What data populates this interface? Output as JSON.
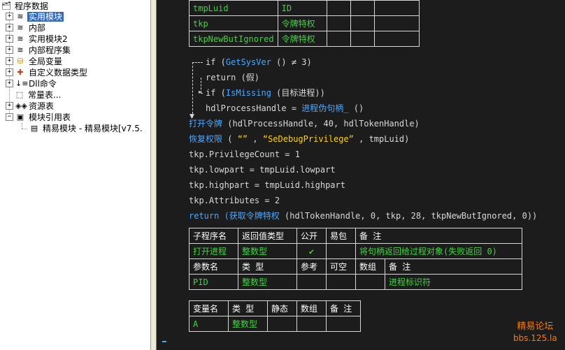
{
  "tree": {
    "root": "程序数据",
    "items": [
      {
        "label": "实用模块",
        "selected": true
      },
      {
        "label": "内部"
      },
      {
        "label": "实用模块2"
      },
      {
        "label": "内部程序集"
      },
      {
        "label": "全局变量"
      },
      {
        "label": "自定义数据类型"
      },
      {
        "label": "Dll命令"
      },
      {
        "label": "常量表..."
      },
      {
        "label": "资源表"
      },
      {
        "label": "模块引用表"
      }
    ],
    "child": "精易模块 - 精易模块[v7.5."
  },
  "vartable": [
    {
      "name": "tmpLuid",
      "type": "ID"
    },
    {
      "name": "tkp",
      "type": "令牌特权"
    },
    {
      "name": "tkpNewButIgnored",
      "type": "令牌特权"
    }
  ],
  "code": {
    "l1_if": "if",
    "l1_fn": "GetSysVer",
    "l1_rest": " () ≠  3)",
    "l2": "return (假)",
    "l3_if": "if",
    "l3_fn": "IsMissing",
    "l3_arg": "目标进程",
    "l3_close": "))",
    "l4_var": "hdlProcessHandle",
    "l4_eq": " = ",
    "l4_fn": "进程伪句柄_",
    "l4_paren": " ()",
    "l5_fn": "打开令牌",
    "l5_args": " (hdlProcessHandle, 40, hdlTokenHandle)",
    "l6_fn": "恢复权限",
    "l6_open": " ( ",
    "l6_s1": "“”",
    "l6_comma": " ,  ",
    "l6_s2": "“SeDebugPrivilege”",
    "l6_rest": " , tmpLuid)",
    "l7_a": "tkp.",
    "l7_b": "PrivilegeCount",
    "l7_c": " =  1",
    "l8_a": "tkp.",
    "l8_b": "lowpart",
    "l8_c": " =  tmpLuid.",
    "l8_d": "lowpart",
    "l9_a": "tkp.",
    "l9_b": "highpart",
    "l9_c": " =  tmpLuid.",
    "l9_d": "highpart",
    "l10_a": "tkp.",
    "l10_b": "Attributes",
    "l10_c": " =  2",
    "l11_kw": "return (",
    "l11_fn": "获取令牌特权",
    "l11_rest": " (hdlTokenHandle, 0, tkp, 28, tkpNewButIgnored, 0))"
  },
  "subtable": {
    "headers": [
      "子程序名",
      "返回值类型",
      "公开",
      "易包",
      "备 注"
    ],
    "row": {
      "name": "打开进程",
      "ret": "整数型",
      "public": "✔",
      "pkg": "",
      "note": "将句柄返回给过程对象(失败返回 0)"
    },
    "param_headers": [
      "参数名",
      "类 型",
      "参考",
      "可空",
      "数组",
      "备 注"
    ],
    "param_row": {
      "name": "PID",
      "type": "整数型",
      "ref": "",
      "null": "",
      "arr": "",
      "note": "进程标识符"
    }
  },
  "localtable": {
    "headers": [
      "变量名",
      "类 型",
      "静态",
      "数组",
      "备 注"
    ],
    "row": {
      "name": "A",
      "type": "整数型",
      "static": "",
      "arr": "",
      "note": ""
    }
  },
  "watermark": {
    "line1": "精易论坛",
    "line2": "bbs.125.la"
  }
}
